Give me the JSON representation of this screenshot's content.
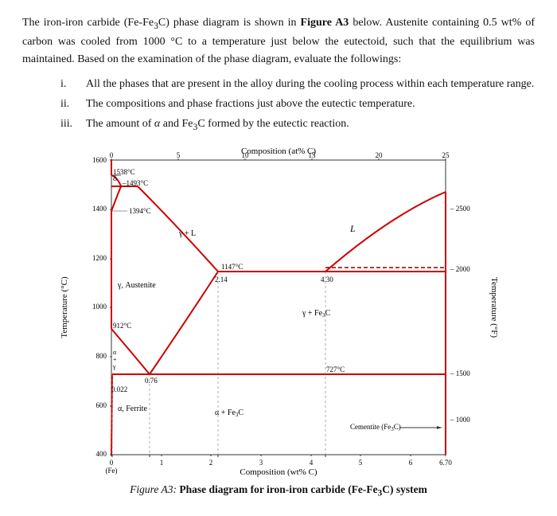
{
  "intro": {
    "paragraph": "The iron-iron carbide (Fe-Fe₃C) phase diagram is shown in Figure A3 below. Austenite containing 0.5 wt% of carbon was cooled from 1000 °C to a temperature just below the eutectoid, such that the equilibrium was maintained. Based on the examination of the phase diagram, evaluate the followings:",
    "figure_ref": "Figure A3",
    "items": [
      {
        "num": "i.",
        "text": "All the phases that are present in the alloy during the cooling process within each temperature range."
      },
      {
        "num": "ii.",
        "text": "The compositions and phase fractions just above the eutectic temperature."
      },
      {
        "num": "iii.",
        "text": "The amount of α and Fe₃C formed by the eutectic reaction."
      }
    ]
  },
  "diagram": {
    "composition_top_label": "Composition (at% C)",
    "composition_bottom_label": "Composition (wt% C)",
    "temp_left_label": "Temperature (°C)",
    "temp_right_label": "Temperature (°F)",
    "figure_caption": "Figure A3: Phase diagram for iron-iron carbide (Fe-Fe₃C) system",
    "top_axis_values": [
      "0",
      "5",
      "10",
      "15",
      "20",
      "25"
    ],
    "bottom_axis_values": [
      "0",
      "1",
      "2",
      "3",
      "4",
      "5",
      "6",
      "6.70"
    ],
    "left_axis_values": [
      "400",
      "600",
      "800",
      "1000",
      "1200",
      "1400",
      "1600"
    ],
    "right_axis_values": [
      "1000",
      "1500",
      "2000",
      "2500"
    ],
    "key_temps": {
      "t1538": "1538°C",
      "t1493": "1493°C",
      "t1394": "1394°C",
      "t1147": "1147°C",
      "t912": "912°C",
      "t727": "727°C"
    },
    "key_comps": {
      "c214": "2.14",
      "c430": "4.30",
      "c076": "0.76",
      "c022": "0.022"
    },
    "labels": {
      "L": "L",
      "y_L": "γ + L",
      "delta": "δ",
      "y_austenite": "γ, Austenite",
      "y_Fe3C": "γ + Fe₃C",
      "alpha_ferrite": "α, Ferrite",
      "alpha_Fe3C": "α + Fe₃C",
      "cementite": "Cementite (Fe₃C)",
      "alpha_plus_y": "α\n+\nγ"
    },
    "fe_label": "(Fe)"
  }
}
